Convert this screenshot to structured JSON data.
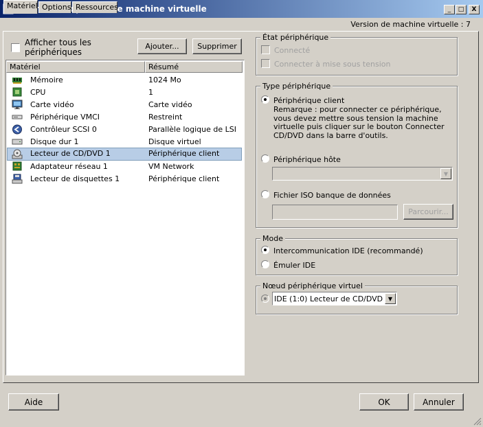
{
  "window": {
    "title": "Ubuntu - Propriétés de machine virtuelle",
    "minimize_glyph": "_",
    "maximize_glyph": "□",
    "close_glyph": "X"
  },
  "tabs": [
    {
      "label": "Matériel",
      "active": true
    },
    {
      "label": "Options",
      "active": false
    },
    {
      "label": "Ressources",
      "active": false
    }
  ],
  "version_text": "Version de machine virtuelle : 7",
  "left": {
    "show_all_label": "Afficher tous les périphériques",
    "show_all_checked": false,
    "add_button": "Ajouter...",
    "remove_button": "Supprimer",
    "columns": {
      "hardware": "Matériel",
      "summary": "Résumé"
    },
    "devices": [
      {
        "name": "Mémoire",
        "summary": "1024 Mo",
        "icon": "memory-icon",
        "selected": false
      },
      {
        "name": "CPU",
        "summary": "1",
        "icon": "cpu-icon",
        "selected": false
      },
      {
        "name": "Carte vidéo",
        "summary": "Carte vidéo",
        "icon": "monitor-icon",
        "selected": false
      },
      {
        "name": "Périphérique VMCI",
        "summary": "Restreint",
        "icon": "vmci-icon",
        "selected": false
      },
      {
        "name": "Contrôleur SCSI 0",
        "summary": "Parallèle logique de LSI",
        "icon": "scsi-controller-icon",
        "selected": false
      },
      {
        "name": "Disque dur 1",
        "summary": "Disque virtuel",
        "icon": "hard-disk-icon",
        "selected": false
      },
      {
        "name": "Lecteur de CD/DVD 1",
        "summary": "Périphérique client",
        "icon": "cd-dvd-icon",
        "selected": true
      },
      {
        "name": "Adaptateur réseau 1",
        "summary": "VM Network",
        "icon": "network-adapter-icon",
        "selected": false
      },
      {
        "name": "Lecteur de disquettes 1",
        "summary": "Périphérique client",
        "icon": "floppy-icon",
        "selected": false
      }
    ]
  },
  "device_status": {
    "legend": "État périphérique",
    "connected": "Connecté",
    "connect_at_power_on": "Connecter à mise sous tension"
  },
  "device_type": {
    "legend": "Type périphérique",
    "client_device": "Périphérique client",
    "client_note": "Remarque : pour connecter ce périphérique, vous devez mettre sous tension la machine virtuelle puis cliquer sur le bouton Connecter CD/DVD dans la barre d'outils.",
    "host_device": "Périphérique hôte",
    "host_device_value": "",
    "iso_file": "Fichier ISO banque de données",
    "iso_path_value": "",
    "browse_button": "Parcourir...",
    "selected": "client_device"
  },
  "mode": {
    "legend": "Mode",
    "passthrough": "Intercommunication IDE (recommandé)",
    "emulate": "Émuler IDE",
    "selected": "passthrough"
  },
  "virtual_node": {
    "legend": "Nœud périphérique virtuel",
    "value": "IDE (1:0) Lecteur de CD/DVD 1"
  },
  "footer": {
    "help": "Aide",
    "ok": "OK",
    "cancel": "Annuler"
  }
}
